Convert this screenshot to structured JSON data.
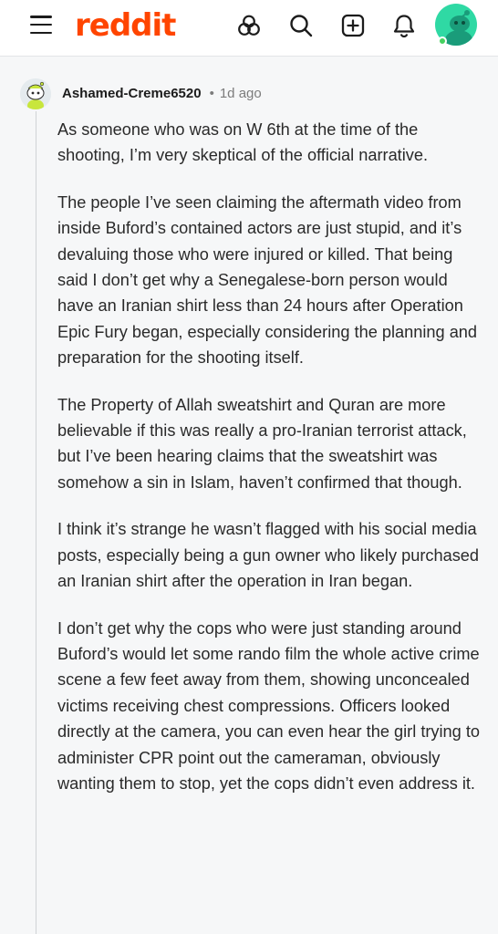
{
  "header": {
    "logo_text": "reddit",
    "icons": [
      "menu-icon",
      "explore-icon",
      "search-icon",
      "create-post-icon",
      "notifications-icon",
      "user-avatar"
    ]
  },
  "comment": {
    "username": "Ashamed-Creme6520",
    "separator": "•",
    "age": "1d ago",
    "paragraphs": [
      "As someone who was on W 6th at the time of the shooting, I’m very skeptical of the official narrative.",
      "The people I’ve seen claiming the aftermath video from inside Buford’s contained actors are just stupid, and it’s devaluing those who were injured or killed. That being said I don’t get why a Senegalese-born person would have an Iranian shirt less than 24 hours after Operation Epic Fury began, especially considering the planning and preparation for the shooting itself.",
      "The Property of Allah sweatshirt and Quran are more believable if this was really a pro-Iranian terrorist attack, but I’ve been hearing claims that the sweatshirt was somehow a sin in Islam, haven’t confirmed that though.",
      "I think it’s strange he wasn’t flagged with his social media posts, especially being a gun owner who likely purchased an Iranian shirt after the operation in Iran began.",
      "I don’t get why the cops who were just standing around Buford’s would let some rando film the whole active crime scene a few feet away from them, showing unconcealed victims receiving chest compressions. Officers looked directly at the camera, you can even hear the girl trying to administer CPR point out the cameraman, obviously wanting them to stop, yet the cops didn’t even address it."
    ]
  },
  "colors": {
    "brand": "#ff4500",
    "avatar_bg": "#2fd9a4",
    "online": "#46d160",
    "thread_line": "#d0d3d6"
  }
}
